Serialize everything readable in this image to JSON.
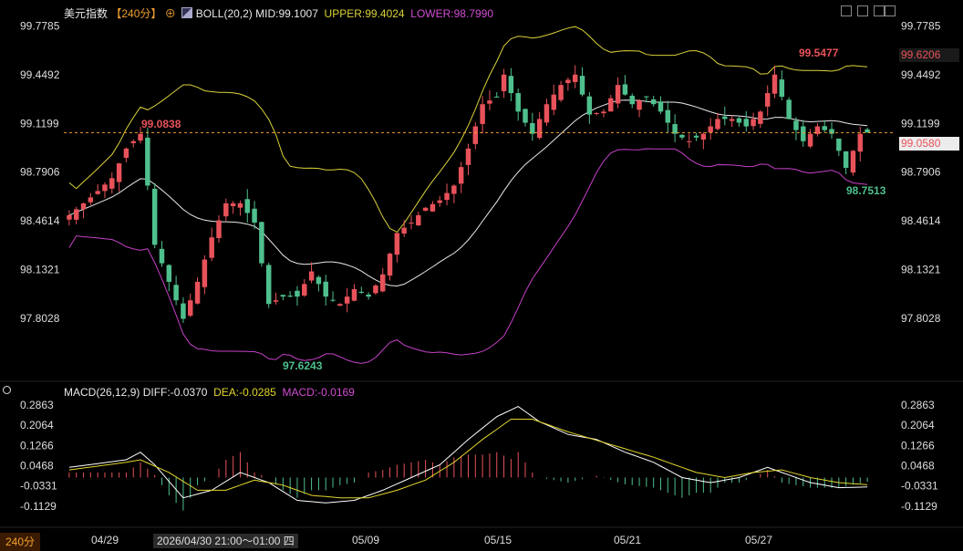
{
  "header": {
    "symbol": "美元指数",
    "period": "【240分】",
    "period_icon": "plus-circle-icon",
    "indicator_icon": "chart-icon",
    "boll_name": "BOLL(20,2)",
    "mid": "MID:99.1007",
    "upper": "UPPER:99.4024",
    "lower": "LOWER:98.7990"
  },
  "macd_header": {
    "name": "MACD(26,12,9)",
    "diff": "DIFF:-0.0370",
    "dea": "DEA:-0.0285",
    "macd": "MACD:-0.0169"
  },
  "toolbar": [
    "grid-icon",
    "grid-icon",
    "grid-icon",
    "expand-icon"
  ],
  "footer": {
    "period_label": "240分",
    "crosshair_time": "2026/04/30 21:00～01:00 四"
  },
  "price_axis": {
    "left_ticks": [
      "99.7785",
      "99.4492",
      "99.1199",
      "98.7906",
      "98.4614",
      "98.1321",
      "97.8028"
    ],
    "right_ticks": [
      "99.7785",
      "99.4492",
      "99.1199",
      "98.7906",
      "98.4614",
      "98.1321",
      "97.8028"
    ],
    "right_tags": {
      "upper": "99.6206",
      "last": "99.0580"
    }
  },
  "macd_axis": {
    "ticks": [
      "0.2863",
      "0.2064",
      "0.1266",
      "0.0468",
      "-0.0331",
      "-0.1129"
    ]
  },
  "annotations": {
    "high1": "99.0838",
    "low": "97.6243",
    "high2": "99.5477",
    "low2": "98.7513"
  },
  "x_labels": [
    "04/29",
    "05/09",
    "05/15",
    "05/21",
    "05/27"
  ],
  "colors": {
    "up": "#e8525a",
    "down": "#4fc08d",
    "upper_band": "#d9d23a",
    "mid_band": "#e8e8e8",
    "lower_band": "#c640c8",
    "diff_line": "#ffffff",
    "dea_line": "#e2d52c",
    "crosshair": "#f0a030"
  },
  "chart_data": {
    "type": "candlestick",
    "ylim": [
      97.55,
      99.8
    ],
    "crosshair_price": 99.058,
    "main_series": {
      "close_path_keypoints": [
        [
          0,
          98.5
        ],
        [
          3,
          98.62
        ],
        [
          6,
          98.75
        ],
        [
          8,
          98.95
        ],
        [
          10,
          99.05
        ],
        [
          11,
          98.7
        ],
        [
          12,
          98.3
        ],
        [
          14,
          98.05
        ],
        [
          16,
          97.8
        ],
        [
          18,
          98.05
        ],
        [
          20,
          98.35
        ],
        [
          22,
          98.58
        ],
        [
          24,
          98.58
        ],
        [
          26,
          98.45
        ],
        [
          28,
          97.9
        ],
        [
          30,
          97.95
        ],
        [
          32,
          97.95
        ],
        [
          34,
          98.12
        ],
        [
          36,
          97.95
        ],
        [
          38,
          97.9
        ],
        [
          40,
          98.0
        ],
        [
          42,
          97.95
        ],
        [
          44,
          98.1
        ],
        [
          46,
          98.38
        ],
        [
          48,
          98.45
        ],
        [
          50,
          98.55
        ],
        [
          52,
          98.6
        ],
        [
          54,
          98.7
        ],
        [
          56,
          98.95
        ],
        [
          58,
          99.25
        ],
        [
          60,
          99.3
        ],
        [
          61,
          99.45
        ],
        [
          63,
          99.2
        ],
        [
          65,
          99.05
        ],
        [
          67,
          99.25
        ],
        [
          69,
          99.38
        ],
        [
          71,
          99.45
        ],
        [
          73,
          99.18
        ],
        [
          75,
          99.2
        ],
        [
          77,
          99.38
        ],
        [
          79,
          99.25
        ],
        [
          81,
          99.3
        ],
        [
          83,
          99.2
        ],
        [
          85,
          99.05
        ],
        [
          87,
          99.0
        ],
        [
          89,
          99.05
        ],
        [
          91,
          99.15
        ],
        [
          93,
          99.15
        ],
        [
          95,
          99.1
        ],
        [
          97,
          99.2
        ],
        [
          99,
          99.45
        ],
        [
          101,
          99.15
        ],
        [
          103,
          99.0
        ],
        [
          105,
          99.1
        ],
        [
          107,
          99.05
        ],
        [
          109,
          98.82
        ],
        [
          111,
          99.05
        ],
        [
          112,
          99.058
        ]
      ]
    },
    "macd_ylim": [
      -0.16,
      0.3
    ],
    "macd_series": {
      "diff_keypoints": [
        [
          0,
          0.04
        ],
        [
          8,
          0.07
        ],
        [
          10,
          0.1
        ],
        [
          12,
          0.05
        ],
        [
          16,
          -0.08
        ],
        [
          20,
          -0.05
        ],
        [
          24,
          0.02
        ],
        [
          28,
          -0.02
        ],
        [
          32,
          -0.09
        ],
        [
          36,
          -0.1
        ],
        [
          40,
          -0.09
        ],
        [
          44,
          -0.05
        ],
        [
          48,
          0.0
        ],
        [
          52,
          0.05
        ],
        [
          56,
          0.15
        ],
        [
          60,
          0.24
        ],
        [
          63,
          0.28
        ],
        [
          66,
          0.22
        ],
        [
          70,
          0.17
        ],
        [
          74,
          0.15
        ],
        [
          78,
          0.1
        ],
        [
          82,
          0.06
        ],
        [
          86,
          0.0
        ],
        [
          90,
          -0.02
        ],
        [
          94,
          0.0
        ],
        [
          98,
          0.04
        ],
        [
          100,
          0.02
        ],
        [
          104,
          -0.02
        ],
        [
          108,
          -0.04
        ],
        [
          112,
          -0.037
        ]
      ],
      "dea_keypoints": [
        [
          0,
          0.03
        ],
        [
          8,
          0.06
        ],
        [
          10,
          0.07
        ],
        [
          14,
          0.02
        ],
        [
          18,
          -0.05
        ],
        [
          22,
          -0.05
        ],
        [
          26,
          -0.01
        ],
        [
          30,
          -0.03
        ],
        [
          34,
          -0.07
        ],
        [
          38,
          -0.08
        ],
        [
          42,
          -0.08
        ],
        [
          46,
          -0.05
        ],
        [
          50,
          -0.01
        ],
        [
          54,
          0.06
        ],
        [
          58,
          0.15
        ],
        [
          62,
          0.23
        ],
        [
          65,
          0.23
        ],
        [
          70,
          0.18
        ],
        [
          76,
          0.13
        ],
        [
          82,
          0.08
        ],
        [
          88,
          0.02
        ],
        [
          92,
          0.0
        ],
        [
          96,
          0.02
        ],
        [
          100,
          0.03
        ],
        [
          104,
          0.0
        ],
        [
          108,
          -0.02
        ],
        [
          112,
          -0.0285
        ]
      ]
    }
  }
}
